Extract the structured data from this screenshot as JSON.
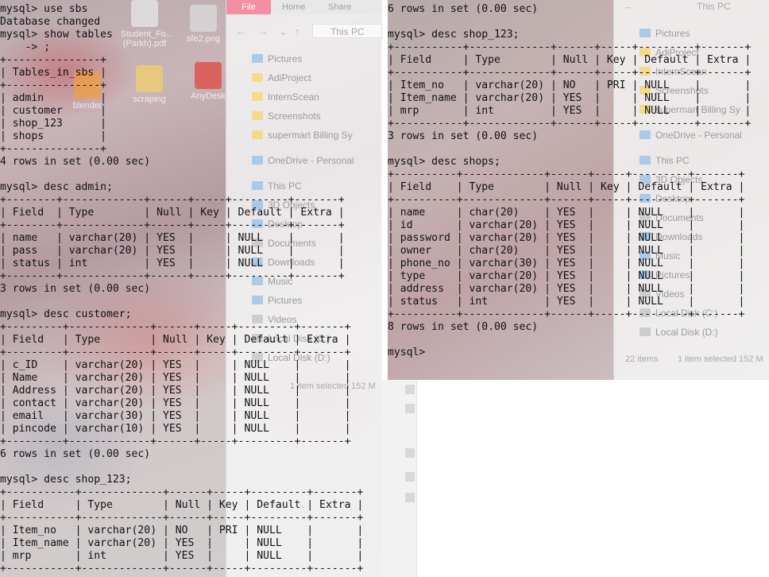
{
  "desktop": {
    "icons": [
      {
        "label": "Student_Fo...\n(Parkh).pdf",
        "name": "student-pdf-icon"
      },
      {
        "label": "sfe2.png",
        "name": "image-file-icon"
      },
      {
        "label": "blender",
        "name": "blender-icon"
      },
      {
        "label": "scraping",
        "name": "folder-icon"
      },
      {
        "label": "AnyDesk",
        "name": "anydesk-icon"
      }
    ]
  },
  "explorer_left": {
    "ribbon_tabs": [
      "File",
      "Home",
      "Share"
    ],
    "path": "This PC",
    "nav_items": [
      "Pictures",
      "AdiProject",
      "InternScean",
      "Screenshots",
      "supermart Billing Sy",
      "OneDrive - Personal",
      "This PC",
      "3D Objects",
      "Desktop",
      "Documents",
      "Downloads",
      "Music",
      "Pictures",
      "Videos",
      "Local Disk (C:)",
      "Local Disk (D:)"
    ],
    "status": "1 item selected  152 M"
  },
  "explorer_right": {
    "path": "This PC",
    "nav_items": [
      "Pictures",
      "AdiProject",
      "InternScean",
      "Screenshots",
      "supermart Billing Sy",
      "OneDrive - Personal",
      "This PC",
      "3D Objects",
      "Desktop",
      "Documents",
      "Downloads",
      "Music",
      "Pictures",
      "Videos",
      "Local Disk (C:)",
      "Local Disk (D:)"
    ],
    "status_items": "22 items",
    "status_selected": "1 item selected  152 M"
  },
  "console_left": {
    "lines": [
      "mysql> use sbs",
      "Database changed",
      "mysql> show tables",
      "    -> ;",
      "+---------------+",
      "| Tables_in_sbs |",
      "+---------------+",
      "| admin         |",
      "| customer      |",
      "| shop_123      |",
      "| shops         |",
      "+---------------+",
      "4 rows in set (0.00 sec)",
      "",
      "mysql> desc admin;",
      "+--------+-------------+------+-----+---------+-------+",
      "| Field  | Type        | Null | Key | Default | Extra |",
      "+--------+-------------+------+-----+---------+-------+",
      "| name   | varchar(20) | YES  |     | NULL    |       |",
      "| pass   | varchar(20) | YES  |     | NULL    |       |",
      "| status | int         | YES  |     | NULL    |       |",
      "+--------+-------------+------+-----+---------+-------+",
      "3 rows in set (0.00 sec)",
      "",
      "mysql> desc customer;",
      "+---------+-------------+------+-----+---------+-------+",
      "| Field   | Type        | Null | Key | Default | Extra |",
      "+---------+-------------+------+-----+---------+-------+",
      "| c_ID    | varchar(20) | YES  |     | NULL    |       |",
      "| Name    | varchar(20) | YES  |     | NULL    |       |",
      "| Address | varchar(20) | YES  |     | NULL    |       |",
      "| contact | varchar(20) | YES  |     | NULL    |       |",
      "| email   | varchar(30) | YES  |     | NULL    |       |",
      "| pincode | varchar(10) | YES  |     | NULL    |       |",
      "+---------+-------------+------+-----+---------+-------+",
      "6 rows in set (0.00 sec)",
      "",
      "mysql> desc shop_123;",
      "+-----------+-------------+------+-----+---------+-------+",
      "| Field     | Type        | Null | Key | Default | Extra |",
      "+-----------+-------------+------+-----+---------+-------+",
      "| Item_no   | varchar(20) | NO   | PRI | NULL    |       |",
      "| Item_name | varchar(20) | YES  |     | NULL    |       |",
      "| mrp       | int         | YES  |     | NULL    |       |",
      "+-----------+-------------+------+-----+---------+-------+"
    ]
  },
  "console_right": {
    "lines": [
      "6 rows in set (0.00 sec)",
      "",
      "mysql> desc shop_123;",
      "+-----------+-------------+------+-----+---------+-------+",
      "| Field     | Type        | Null | Key | Default | Extra |",
      "+-----------+-------------+------+-----+---------+-------+",
      "| Item_no   | varchar(20) | NO   | PRI | NULL    |       |",
      "| Item_name | varchar(20) | YES  |     | NULL    |       |",
      "| mrp       | int         | YES  |     | NULL    |       |",
      "+-----------+-------------+------+-----+---------+-------+",
      "3 rows in set (0.00 sec)",
      "",
      "mysql> desc shops;",
      "+----------+-------------+------+-----+---------+-------+",
      "| Field    | Type        | Null | Key | Default | Extra |",
      "+----------+-------------+------+-----+---------+-------+",
      "| name     | char(20)    | YES  |     | NULL    |       |",
      "| id       | varchar(20) | YES  |     | NULL    |       |",
      "| password | varchar(20) | YES  |     | NULL    |       |",
      "| owner    | char(20)    | YES  |     | NULL    |       |",
      "| phone_no | varchar(30) | YES  |     | NULL    |       |",
      "| type     | varchar(20) | YES  |     | NULL    |       |",
      "| address  | varchar(20) | YES  |     | NULL    |       |",
      "| status   | int         | YES  |     | NULL    |       |",
      "+----------+-------------+------+-----+---------+-------+",
      "8 rows in set (0.00 sec)",
      "",
      "mysql>"
    ]
  },
  "colors": {
    "console_text": "#111111",
    "file_tab": "#f48fa3",
    "explorer_bg": "#f6f6f6"
  }
}
